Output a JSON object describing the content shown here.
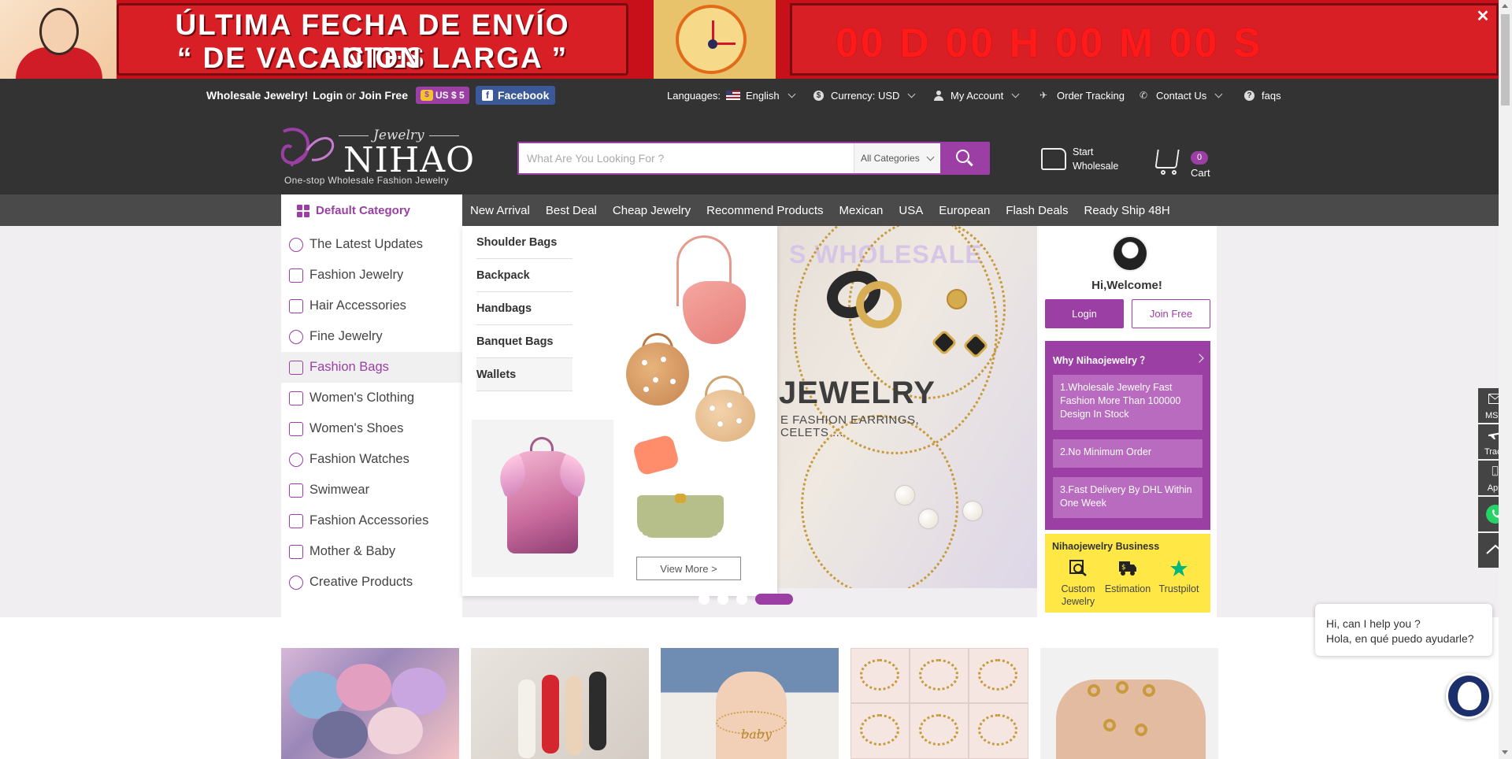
{
  "promo": {
    "line1": "ÚLTIMA FECHA DE ENVÍO ANTES",
    "line2": "“ DE VACACION LARGA ”",
    "countdown": "00 D 00 H 00 M 00 S",
    "close": "✕"
  },
  "topbar": {
    "wholesale_text": "Wholesale Jewelry!",
    "login": "Login",
    "or": "or",
    "join": "Join Free",
    "coupon": "US $ 5",
    "coupon_icon": "$",
    "facebook": "Facebook",
    "facebook_icon": "f",
    "languages_label": "Languages:",
    "language": "English",
    "currency_icon": "$",
    "currency": "Currency: USD",
    "my_account": "My Account",
    "plane_icon": "✈",
    "order_tracking": "Order Tracking",
    "phone_icon": "✆",
    "contact_us": "Contact Us",
    "faq_icon": "?",
    "faqs": "faqs"
  },
  "header": {
    "logo_jewelry": "Jewelry",
    "logo_nihao": "NIHAO",
    "logo_tagline": "One-stop Wholesale Fashion Jewelry",
    "search_placeholder": "What Are You Looking For ?",
    "search_category": "All Categories",
    "start_wholesale_1": "Start",
    "start_wholesale_2": "Wholesale",
    "cart_count": "0",
    "cart_label": "Cart"
  },
  "nav": {
    "default_category": "Default Category",
    "links": [
      "New Arrival",
      "Best Deal",
      "Cheap Jewelry",
      "Recommend Products",
      "Mexican",
      "USA",
      "European",
      "Flash Deals",
      "Ready Ship 48H"
    ]
  },
  "sidebar": {
    "items": [
      "The Latest Updates",
      "Fashion Jewelry",
      "Hair Accessories",
      "Fine Jewelry",
      "Fashion Bags",
      "Women's Clothing",
      "Women's Shoes",
      "Fashion Watches",
      "Swimwear",
      "Fashion Accessories",
      "Mother & Baby",
      "Creative Products"
    ],
    "active_index": 4
  },
  "dropdown": {
    "subcategories": [
      "Shoulder Bags",
      "Backpack",
      "Handbags",
      "Banquet Bags",
      "Wallets"
    ],
    "view_more": "View More >"
  },
  "slider": {
    "watermark": "S WHOLESALE",
    "headline": "JEWELRY",
    "sub1": "E FASHION EARRINGS,",
    "sub2": "CELETS ...",
    "slide_count": 4,
    "active_slide": 4
  },
  "welcome": {
    "greeting": "Hi,Welcome!",
    "login": "Login",
    "join": "Join Free",
    "why_title": "Why Nihaojewelry ？",
    "reasons": [
      "1.Wholesale Jewelry Fast Fashion More Than 100000 Design In Stock",
      "2.No Minimum Order",
      "3.Fast Delivery By DHL Within One Week"
    ],
    "business_title": "Nihaojewelry Business",
    "business_items": [
      "Custom Jewelry",
      "Estimation",
      "Trustpilot"
    ]
  },
  "toolbar": {
    "items": [
      "MSG",
      "Track",
      "App",
      "",
      ""
    ]
  },
  "chat": {
    "line1": "Hi, can I help you ?",
    "line2": "Hola, en qué puedo ayudarle?"
  },
  "colors": {
    "brand_purple": "#9b3fa5",
    "topbar_bg": "#333333",
    "nav_bg": "#4a4a4a",
    "promo_red": "#d81f26",
    "business_yellow": "#ffe845",
    "whatsapp_green": "#25d366"
  }
}
